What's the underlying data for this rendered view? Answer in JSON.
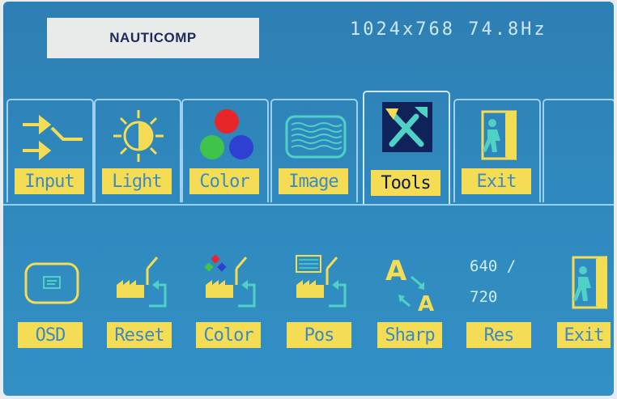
{
  "header": {
    "logo_text": "NAUTICOMP",
    "resolution_text": "1024x768 74.8Hz"
  },
  "tabs": [
    {
      "label": "Input",
      "icon": "input-source-icon"
    },
    {
      "label": "Light",
      "icon": "brightness-icon"
    },
    {
      "label": "Color",
      "icon": "rgb-color-icon"
    },
    {
      "label": "Image",
      "icon": "image-waves-icon"
    },
    {
      "label": "Tools",
      "icon": "tools-icon",
      "active": true
    },
    {
      "label": "Exit",
      "icon": "exit-door-icon"
    }
  ],
  "tools": [
    {
      "label": "OSD",
      "icon": "osd-icon"
    },
    {
      "label": "Reset",
      "icon": "reset-factory-icon"
    },
    {
      "label": "Color",
      "icon": "color-reset-icon"
    },
    {
      "label": "Pos",
      "icon": "position-reset-icon"
    },
    {
      "label": "Sharp",
      "icon": "sharpness-icon"
    },
    {
      "label": "Res",
      "icon": "resolution-toggle",
      "values": [
        "640 /",
        "720"
      ]
    },
    {
      "label": "Exit",
      "icon": "exit-door-icon"
    }
  ],
  "colors": {
    "label_bg": "#f5dc55",
    "label_text": "#3b8ac2",
    "active_label_text": "#0d1c3f",
    "screen_bg": "#2f88bd",
    "icon_teal": "#4fd1c5",
    "icon_yellow": "#f5dc55"
  }
}
